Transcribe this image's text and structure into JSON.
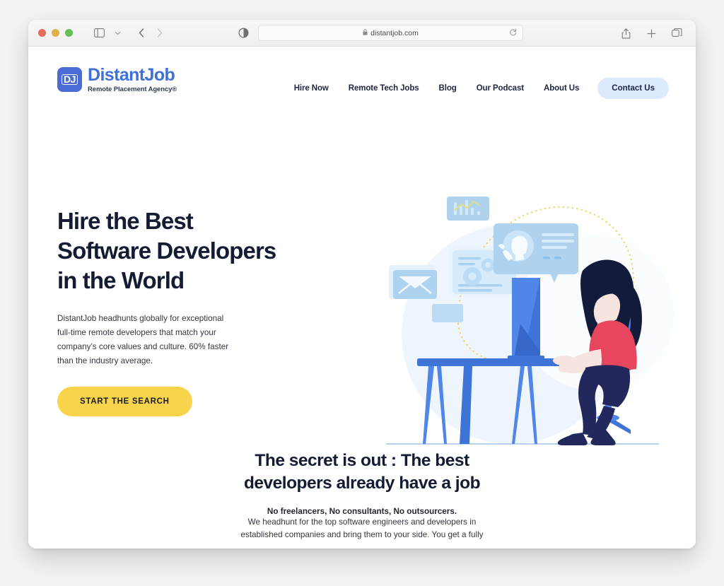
{
  "browser": {
    "traffic_lights": [
      "close",
      "minimize",
      "maximize"
    ],
    "sidebar_toggle_label": "sidebar-toggle",
    "tab_overview_label": "tab-overview",
    "back_label": "back",
    "forward_label": "forward",
    "reader_label": "reader-view",
    "url": "distantjob.com",
    "lock": "ὑ2",
    "reload_label": "reload",
    "share_label": "share",
    "new_tab_label": "new-tab",
    "tabs_label": "show-tabs"
  },
  "site": {
    "logo": {
      "mark_text": "DJ",
      "wordmark": "DistantJob",
      "tagline": "Remote Placement Agency®",
      "mark_color": "#4a6cd4",
      "wordmark_color": "#3f6fd8"
    },
    "nav": {
      "items": [
        {
          "label": "Hire Now"
        },
        {
          "label": "Remote Tech Jobs"
        },
        {
          "label": "Blog"
        },
        {
          "label": "Our Podcast"
        },
        {
          "label": "About Us"
        }
      ],
      "cta": {
        "label": "Contact Us",
        "bg": "#dbeafc",
        "color": "#1c2541"
      }
    },
    "hero": {
      "title_line1": "Hire the Best",
      "title_line2": "Software Developers",
      "title_line3": "in the World",
      "paragraph": "DistantJob headhunts globally for exceptional full-time remote developers that match your company’s core values and culture. 60% faster than the industry average.",
      "cta_label": "START THE SEARCH",
      "cta_bg": "#f7d44c",
      "cta_color": "#1a1a1a",
      "illustration_name": "remote-developer-at-desk-illustration"
    },
    "secret_section": {
      "title_line1": "The secret is out : The best",
      "title_line2": "developers already have a job",
      "lead": "No freelancers, No consultants, No outsourcers.",
      "body_line1": "We headhunt for the top software engineers and developers in",
      "body_line2": "established companies and bring them to your side. You get a fully"
    }
  },
  "colors": {
    "heading": "#141c33",
    "brand_blue": "#3f6fd8",
    "accent_yellow": "#f7d44c",
    "page_bg": "#ffffff"
  }
}
